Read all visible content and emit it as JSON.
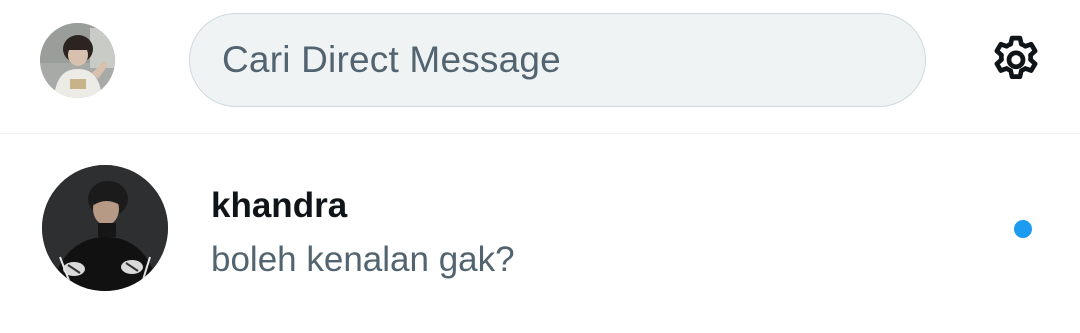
{
  "header": {
    "search": {
      "placeholder": "Cari Direct Message"
    }
  },
  "conversations": [
    {
      "name": "khandra",
      "preview": "boleh kenalan gak?",
      "unread": true
    }
  ],
  "colors": {
    "accent": "#1d9bf0",
    "text_primary": "#0f1419",
    "text_secondary": "#536471",
    "search_bg": "#eff3f4"
  },
  "icons": {
    "settings": "gear-icon",
    "unread": "unread-dot-icon"
  }
}
